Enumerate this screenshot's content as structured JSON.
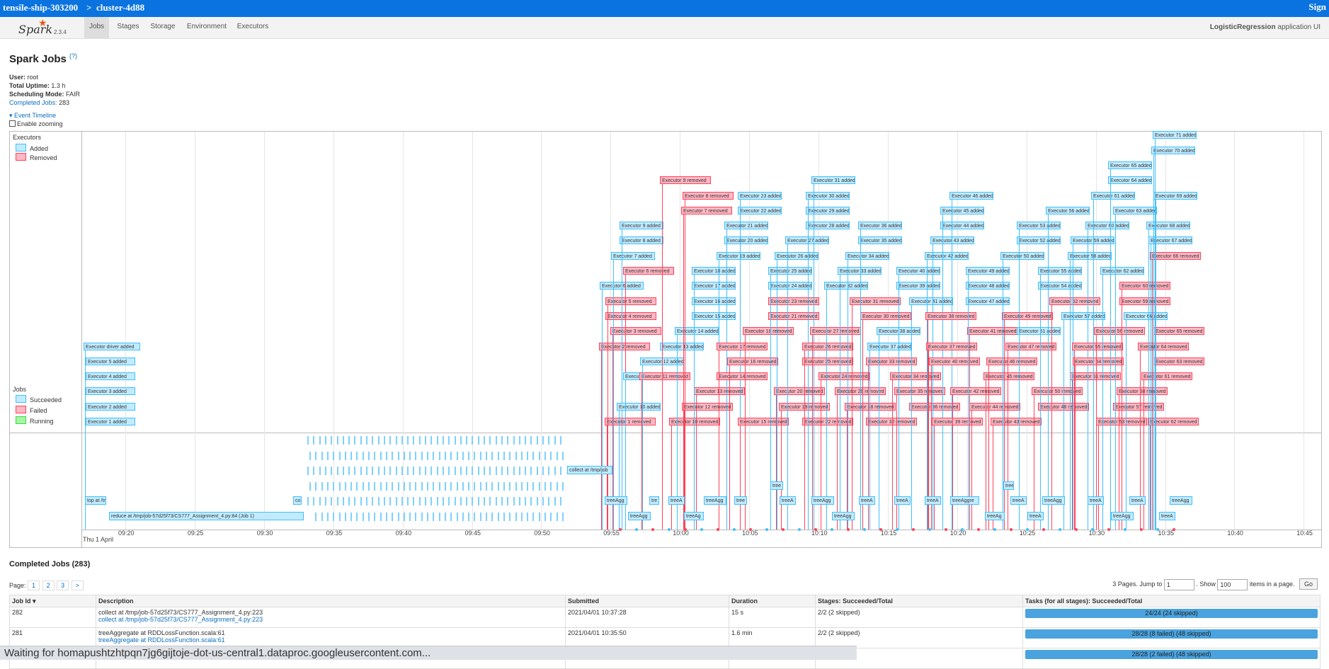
{
  "topbar": {
    "project": "tensile-ship-303200",
    "separator": ">",
    "cluster": "cluster-4d88",
    "sign": "Sign"
  },
  "nav": {
    "logo": "Spark",
    "version": "2.3.4",
    "tabs": [
      "Jobs",
      "Stages",
      "Storage",
      "Environment",
      "Executors"
    ],
    "app_name": "LogisticRegression",
    "app_suffix": "application UI"
  },
  "page": {
    "title": "Spark Jobs",
    "help": "(?)"
  },
  "summary": {
    "user_label": "User:",
    "user": "root",
    "uptime_label": "Total Uptime:",
    "uptime": "1.3 h",
    "mode_label": "Scheduling Mode:",
    "mode": "FAIR",
    "completed_label": "Completed Jobs:",
    "completed": "283"
  },
  "timeline": {
    "event_timeline": "Event Timeline",
    "enable_zooming": "Enable zooming",
    "executors_label": "Executors",
    "legend_added": "Added",
    "legend_removed": "Removed",
    "jobs_label": "Jobs",
    "legend_succeeded": "Succeeded",
    "legend_failed": "Failed",
    "legend_running": "Running",
    "date_label": "Thu 1 April",
    "ticks": [
      "09:20",
      "09:25",
      "09:30",
      "09:35",
      "09:40",
      "09:45",
      "09:50",
      "09:55",
      "10:00",
      "10:05",
      "10:10",
      "10:15",
      "10:20",
      "10:25",
      "10:30",
      "10:35",
      "10:40",
      "10:45"
    ],
    "driver_label": "Executor driver added",
    "job_labels": {
      "top": "top at /tm",
      "reduce": "reduce at /tmp/job-57d25f73/CS777_Assignment_4.py:84 (Job 1)",
      "co": "co",
      "collect": "collect at /tmp/job",
      "tree": "tree"
    },
    "colors": {
      "added": "#c3ebff",
      "added_border": "#3ec0ff",
      "removed": "#ffb9c5",
      "removed_border": "#ff425a",
      "running": "#a6f5a6"
    }
  },
  "completed_jobs": {
    "title": "Completed Jobs (283)",
    "page_label": "Page:",
    "pages": [
      "1",
      "2",
      "3",
      ">"
    ],
    "pages_info": "3 Pages. Jump to",
    "jump_value": "1",
    "show_label": ". Show",
    "show_value": "100",
    "items_label": "items in a page.",
    "go": "Go",
    "headers": [
      "Job Id ▾",
      "Description",
      "Submitted",
      "Duration",
      "Stages: Succeeded/Total",
      "Tasks (for all stages): Succeeded/Total"
    ],
    "rows": [
      {
        "id": "282",
        "desc": "collect at /tmp/job-57d25f73/CS777_Assignment_4.py:223",
        "link": "collect at /tmp/job-57d25f73/CS777_Assignment_4.py:223",
        "submitted": "2021/04/01 10:37:28",
        "duration": "15 s",
        "stages": "2/2 (2 skipped)",
        "tasks": "24/24 (24 skipped)"
      },
      {
        "id": "281",
        "desc": "treeAggregate at RDDLossFunction.scala:61",
        "link": "treeAggregate at RDDLossFunction.scala:61",
        "submitted": "2021/04/01 10:35:50",
        "duration": "1.6 min",
        "stages": "2/2 (2 skipped)",
        "tasks": "28/28 (8 failed) (48 skipped)"
      },
      {
        "id": "",
        "desc": "",
        "link": "",
        "submitted": "",
        "duration": "",
        "stages": "",
        "tasks": "28/28 (2 failed) (48 skipped)"
      }
    ]
  },
  "status_bar": "Waiting for homapushtzhtpqn7jg6gijtoje-dot-us-central1.dataproc.googleusercontent.com..."
}
